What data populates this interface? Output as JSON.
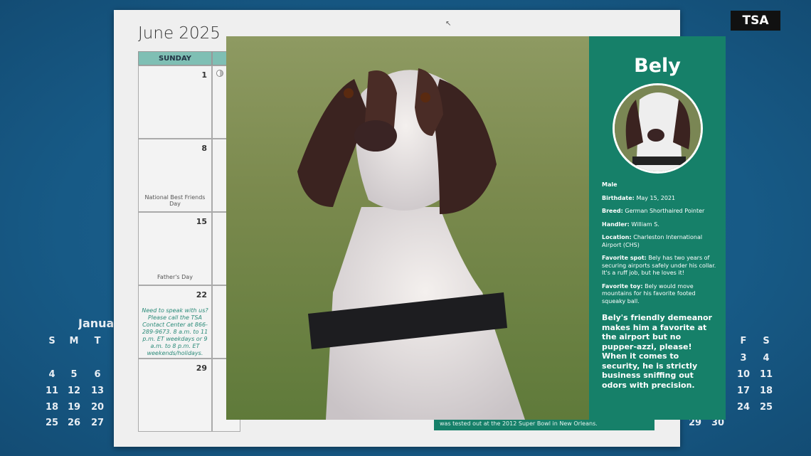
{
  "badge": "TSA",
  "calendar": {
    "title": "June 2025",
    "header": "SUNDAY",
    "cells": [
      {
        "day": "1",
        "note": ""
      },
      {
        "day": "8",
        "note": "National Best Friends Day"
      },
      {
        "day": "15",
        "note": "Father's Day"
      },
      {
        "day": "22",
        "note": "Need to speak with us? Please call the TSA Contact Center at 866-289-9673. 8 a.m. to 11 p.m. ET weekdays or 9 a.m. to 8 p.m. ET weekends/holidays."
      },
      {
        "day": "29",
        "note": ""
      }
    ],
    "strip_text": "was tested out at the 2012 Super Bowl in New Orleans."
  },
  "mini_left": {
    "title": "Januar",
    "days": [
      "S",
      "M",
      "T"
    ],
    "rows": [
      [
        "4",
        "5",
        "6"
      ],
      [
        "11",
        "12",
        "13"
      ],
      [
        "18",
        "19",
        "20"
      ],
      [
        "25",
        "26",
        "27"
      ]
    ]
  },
  "mini_right": {
    "days": [
      "F",
      "S"
    ],
    "rows": [
      [
        "3",
        "4"
      ],
      [
        "10",
        "11"
      ],
      [
        "17",
        "18"
      ],
      [
        "24",
        "25"
      ]
    ],
    "last": [
      "29",
      "30"
    ]
  },
  "profile": {
    "name": "Bely",
    "sex": "Male",
    "facts": [
      {
        "label": "Birthdate:",
        "value": "May 15, 2021"
      },
      {
        "label": "Breed:",
        "value": "German Shorthaired Pointer"
      },
      {
        "label": "Handler:",
        "value": "William S."
      },
      {
        "label": "Location:",
        "value": "Charleston International Airport (CHS)"
      },
      {
        "label": "Favorite spot:",
        "value": "Bely has two years of securing airports safely under his collar. It's a ruff job, but he loves it!"
      },
      {
        "label": "Favorite toy:",
        "value": "Bely would move mountains for his favorite footed squeaky ball."
      }
    ],
    "blurb": "Bely's friendly demeanor makes him a favorite at the airport but no pupper-azzi, please! When it comes to security, he is strictly business sniffing out odors with precision."
  },
  "colors": {
    "teal": "#168069",
    "header": "#7fbfb4",
    "background": "#175a86"
  }
}
